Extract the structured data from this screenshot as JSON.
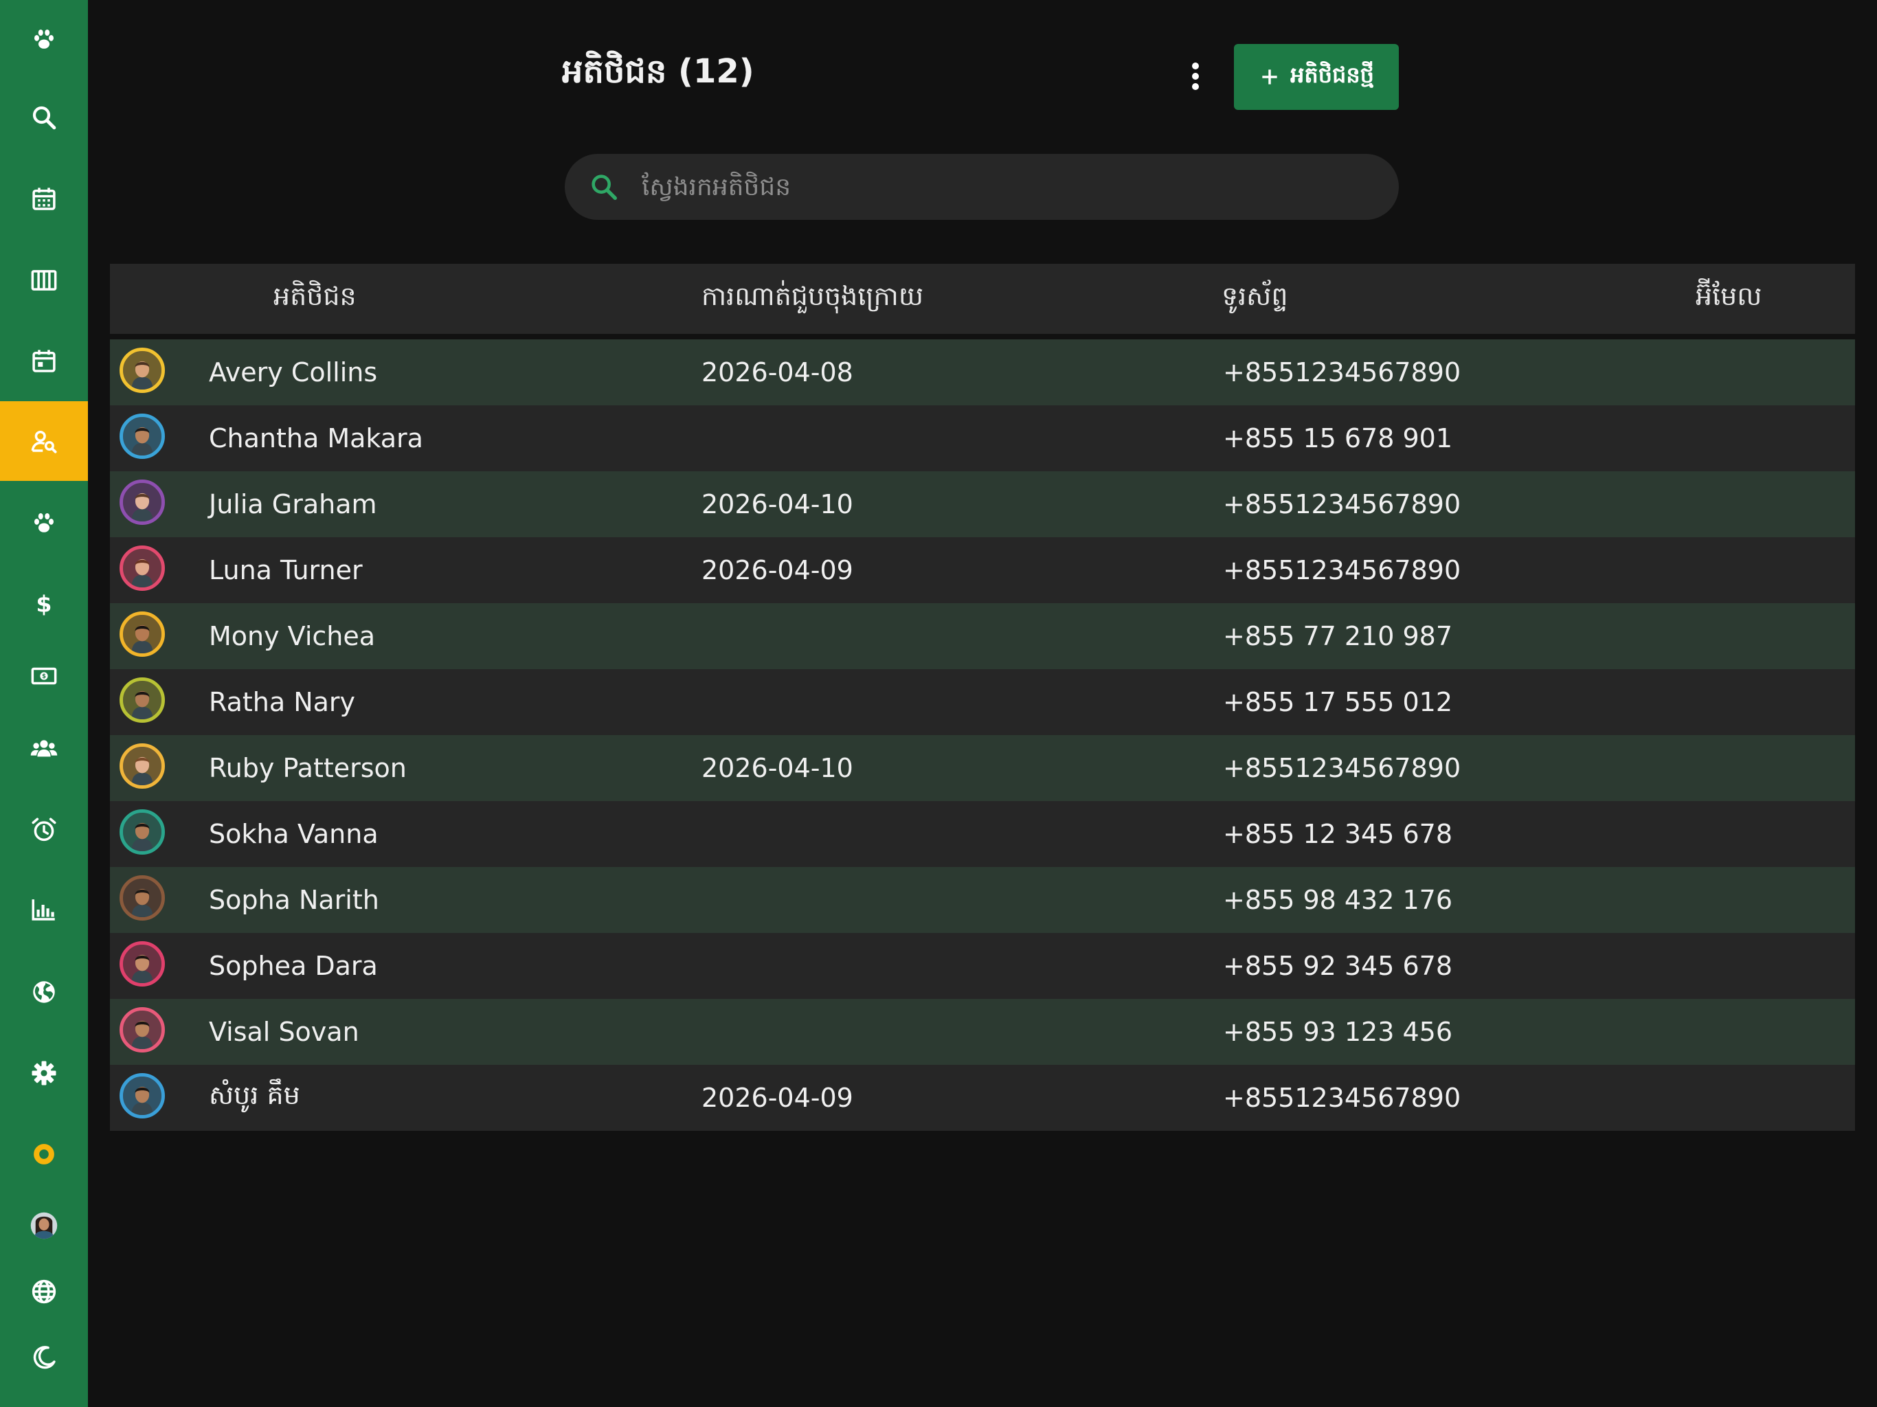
{
  "sidebar": {
    "items": [
      {
        "icon": "paw-logo-icon",
        "active": false
      },
      {
        "icon": "search-icon",
        "active": false
      },
      {
        "icon": "calendar-grid-icon",
        "active": false
      },
      {
        "icon": "columns-icon",
        "active": false
      },
      {
        "icon": "calendar-icon",
        "active": false
      },
      {
        "icon": "customer-search-icon",
        "active": true
      },
      {
        "icon": "paw-icon",
        "active": false
      },
      {
        "icon": "dollar-icon",
        "active": false
      },
      {
        "icon": "banknote-icon",
        "active": false
      },
      {
        "icon": "group-icon",
        "active": false
      },
      {
        "icon": "alarm-clock-icon",
        "active": false
      },
      {
        "icon": "bar-chart-icon",
        "active": false
      },
      {
        "icon": "globe-filled-icon",
        "active": false
      },
      {
        "icon": "settings-gear-icon",
        "active": false
      },
      {
        "icon": "status-ring-icon",
        "active": false
      },
      {
        "icon": "user-avatar-icon",
        "active": false
      },
      {
        "icon": "language-globe-icon",
        "active": false
      },
      {
        "icon": "dark-mode-moon-icon",
        "active": false
      }
    ]
  },
  "header": {
    "title": "អតិថិជន (12)",
    "add_button_label": "អតិថិជនថ្មី"
  },
  "search": {
    "placeholder": "ស្វែងរកអតិថិជន",
    "value": ""
  },
  "table": {
    "columns": [
      "អតិថិជន",
      "ការណាត់ជួបចុងក្រោយ",
      "ទូរស័ព្ទ",
      "អ៊ីមែល"
    ],
    "rows": [
      {
        "name": "Avery Collins",
        "last_appointment": "2026-04-08",
        "phone": "+8551234567890",
        "email": "",
        "ring": "#f2c230",
        "skin": "#d8a27a",
        "hair": "#4a3322"
      },
      {
        "name": "Chantha Makara",
        "last_appointment": "",
        "phone": "+855 15 678 901",
        "email": "",
        "ring": "#3aa3d8",
        "skin": "#b9835c",
        "hair": "#1e1a18"
      },
      {
        "name": "Julia Graham",
        "last_appointment": "2026-04-10",
        "phone": "+8551234567890",
        "email": "",
        "ring": "#8e4fb0",
        "skin": "#e3b49a",
        "hair": "#5a3a28"
      },
      {
        "name": "Luna Turner",
        "last_appointment": "2026-04-09",
        "phone": "+8551234567890",
        "email": "",
        "ring": "#e24a6e",
        "skin": "#e0a98c",
        "hair": "#6a3422"
      },
      {
        "name": "Mony Vichea",
        "last_appointment": "",
        "phone": "+855 77 210 987",
        "email": "",
        "ring": "#f2b52a",
        "skin": "#b57a52",
        "hair": "#1a1512"
      },
      {
        "name": "Ratha Nary",
        "last_appointment": "",
        "phone": "+855 17 555 012",
        "email": "",
        "ring": "#b8c234",
        "skin": "#b07b55",
        "hair": "#1c1714"
      },
      {
        "name": "Ruby Patterson",
        "last_appointment": "2026-04-10",
        "phone": "+8551234567890",
        "email": "",
        "ring": "#f0b53a",
        "skin": "#e2b091",
        "hair": "#7a4b2a"
      },
      {
        "name": "Sokha Vanna",
        "last_appointment": "",
        "phone": "+855 12 345 678",
        "email": "",
        "ring": "#2aa58c",
        "skin": "#b27d57",
        "hair": "#1b1613"
      },
      {
        "name": "Sopha Narith",
        "last_appointment": "",
        "phone": "+855 98 432 176",
        "email": "",
        "ring": "#8a5a3c",
        "skin": "#b07a54",
        "hair": "#1e1915"
      },
      {
        "name": "Sophea Dara",
        "last_appointment": "",
        "phone": "+855 92 345 678",
        "email": "",
        "ring": "#e0406c",
        "skin": "#c58e6a",
        "hair": "#1c1512"
      },
      {
        "name": "Visal Sovan",
        "last_appointment": "",
        "phone": "+855 93 123 456",
        "email": "",
        "ring": "#e85a7a",
        "skin": "#b9845d",
        "hair": "#1b1613"
      },
      {
        "name": "សំបូរ គឹម",
        "last_appointment": "2026-04-09",
        "phone": "+8551234567890",
        "email": "",
        "ring": "#3a9fd8",
        "skin": "#b5805a",
        "hair": "#1a1613"
      }
    ]
  },
  "colors": {
    "sidebar_bg": "#1d7a45",
    "active_nav": "#f6b40b",
    "primary_button": "#1d7a45",
    "search_icon": "#2fa866",
    "background": "#111111"
  }
}
